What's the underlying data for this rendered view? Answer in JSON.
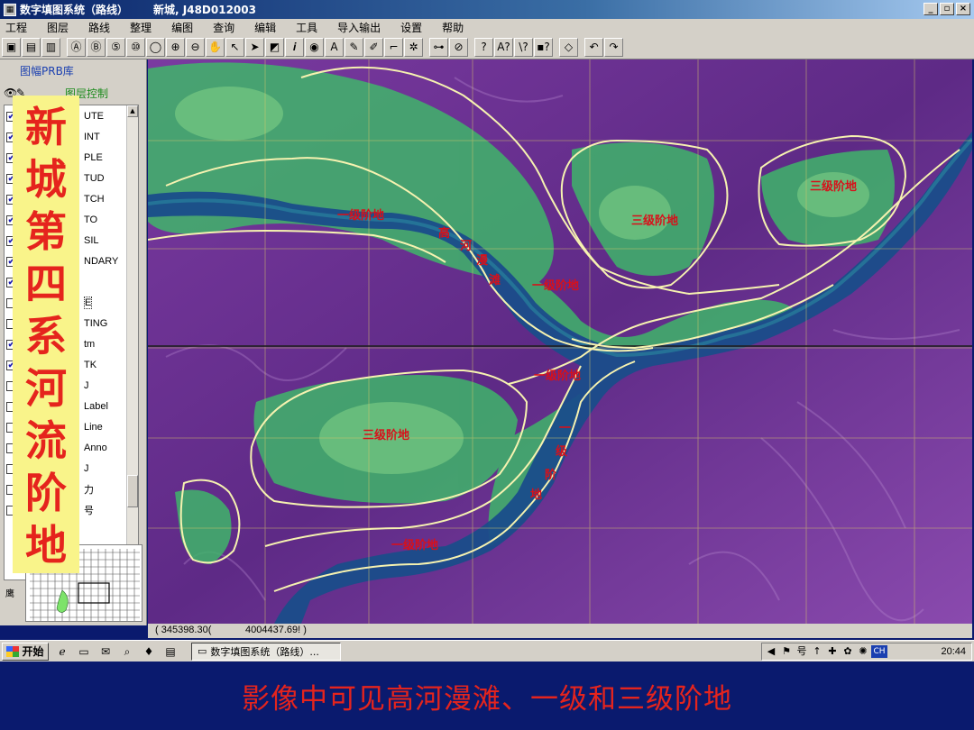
{
  "window": {
    "title": "数字填图系统（路线）",
    "subtitle": "新城, J48D012003",
    "icon": "app-icon",
    "buttons": [
      "_",
      "▫",
      "×"
    ]
  },
  "menu": [
    "工程",
    "图层",
    "路线",
    "整理",
    "编图",
    "查询",
    "编辑",
    "工具",
    "导入输出",
    "设置",
    "帮助"
  ],
  "toolbar": {
    "groups": [
      [
        {
          "icon": "save-icon",
          "glyph": "▣"
        },
        {
          "icon": "layers-icon",
          "glyph": "▤"
        },
        {
          "icon": "print-icon",
          "glyph": "▥"
        }
      ],
      [
        {
          "icon": "zoom-a-icon",
          "glyph": "Ⓐ"
        },
        {
          "icon": "zoom-b-icon",
          "glyph": "Ⓑ"
        },
        {
          "icon": "zoom-5-icon",
          "glyph": "⑤"
        },
        {
          "icon": "zoom-10-icon",
          "glyph": "⑩"
        },
        {
          "icon": "zoom-window-icon",
          "glyph": "◯"
        },
        {
          "icon": "zoom-in-icon",
          "glyph": "⊕"
        },
        {
          "icon": "zoom-out-icon",
          "glyph": "⊖"
        },
        {
          "icon": "pan-hand-icon",
          "glyph": "✋"
        },
        {
          "icon": "select-arrow-icon",
          "glyph": "↖"
        },
        {
          "icon": "select-black-icon",
          "glyph": "➤"
        },
        {
          "icon": "select-box-icon",
          "glyph": "◩"
        },
        {
          "icon": "info-icon",
          "glyph": "𝒊"
        },
        {
          "icon": "point-icon",
          "glyph": "◉"
        },
        {
          "icon": "text-icon",
          "glyph": "A"
        },
        {
          "icon": "pencil-icon",
          "glyph": "✎"
        },
        {
          "icon": "brush-icon",
          "glyph": "✐"
        },
        {
          "icon": "line-icon",
          "glyph": "⌐"
        },
        {
          "icon": "network-icon",
          "glyph": "✲"
        }
      ],
      [
        {
          "icon": "measure-icon",
          "glyph": "⊶"
        },
        {
          "icon": "compass-icon",
          "glyph": "⊘"
        }
      ],
      [
        {
          "icon": "help-point-icon",
          "glyph": "?"
        },
        {
          "icon": "help-text-icon",
          "glyph": "A?"
        },
        {
          "icon": "help-line-icon",
          "glyph": "\\?"
        },
        {
          "icon": "help-area-icon",
          "glyph": "▪?"
        }
      ],
      [
        {
          "icon": "eraser-icon",
          "glyph": "◇"
        }
      ],
      [
        {
          "icon": "undo-icon",
          "glyph": "↶"
        },
        {
          "icon": "redo-icon",
          "glyph": "↷"
        }
      ]
    ]
  },
  "left_panel": {
    "prb_label": "图幅PRB库",
    "layer_control_label": "图层控制",
    "layers": [
      {
        "name": "UTE",
        "checked": true
      },
      {
        "name": "INT",
        "checked": true
      },
      {
        "name": "PLE",
        "checked": true
      },
      {
        "name": "TUD",
        "checked": true
      },
      {
        "name": "TCH",
        "checked": true
      },
      {
        "name": "TO",
        "checked": true
      },
      {
        "name": "SIL",
        "checked": true
      },
      {
        "name": "NDARY",
        "checked": true
      },
      {
        "name": "",
        "checked": true
      },
      {
        "name": "E",
        "checked": false,
        "selected": true
      },
      {
        "name": "TING",
        "checked": false
      },
      {
        "name": "tm",
        "checked": true
      },
      {
        "name": "TK",
        "checked": true
      },
      {
        "name": "J",
        "checked": false
      },
      {
        "name": "Label",
        "checked": false
      },
      {
        "name": "Line",
        "checked": false
      },
      {
        "name": "Anno",
        "checked": false
      },
      {
        "name": "J",
        "checked": false
      },
      {
        "name": "力",
        "checked": false
      },
      {
        "name": "号",
        "checked": false
      }
    ],
    "overview_label": "鹰"
  },
  "banner": {
    "text": "新城第四系河流阶地",
    "color": "#e5241d",
    "background": "#f9f48a"
  },
  "map": {
    "labels": {
      "terrace1_nw": "一级阶地",
      "floodplain_1": "高",
      "floodplain_2": "河",
      "floodplain_3": "漫",
      "floodplain_4": "滩",
      "terrace1_center": "一级阶地",
      "terrace3_ne1": "三级阶地",
      "terrace3_ne2": "三级阶地",
      "terrace1_junction": "一级阶地",
      "terrace3_sw": "三级阶地",
      "terrace1_v1": "一",
      "terrace1_v2": "级",
      "terrace1_v3": "阶",
      "terrace1_v4": "地",
      "terrace1_south": "一级阶地"
    },
    "label_color": "#d8101a"
  },
  "coords": {
    "x": "( 345398.30(",
    "y": "4004437.69! )"
  },
  "taskbar": {
    "start_label": "开始",
    "quick_launch": [
      "ie-icon",
      "desktop-icon",
      "outlook-icon",
      "search-icon",
      "balloon-icon",
      "doc-icon"
    ],
    "task_label": "数字填图系统（路线）...",
    "tray_icons": [
      "speaker-icon",
      "flag-icon",
      "ime-icon",
      "net-icon",
      "tool-icon",
      "app-icon",
      "gear-icon"
    ],
    "lang": "CH",
    "clock": "20:44"
  },
  "caption": {
    "text": "影像中可见高河漫滩、一级和三级阶地"
  }
}
